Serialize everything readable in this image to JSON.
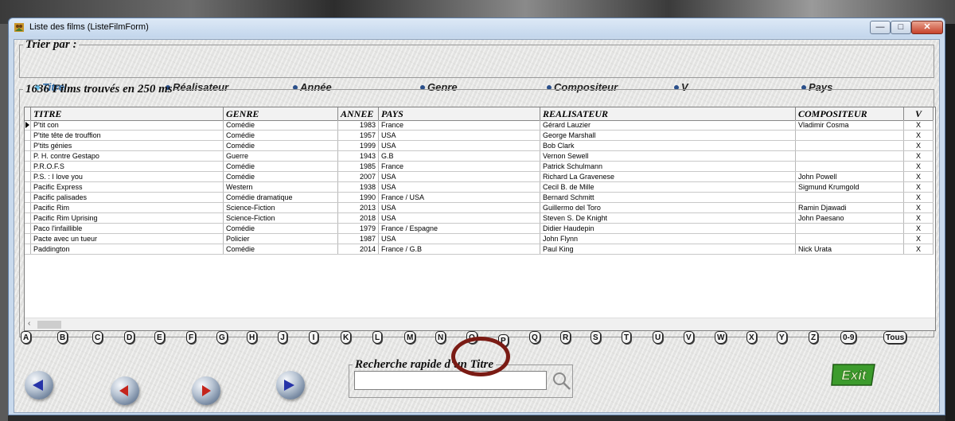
{
  "window": {
    "title": "Liste des films (ListeFilmForm)",
    "controls": {
      "minimize": "—",
      "maximize": "□",
      "close": "✕"
    }
  },
  "sort": {
    "legend": "Trier par :",
    "options": [
      {
        "label": "Titre",
        "checked": true
      },
      {
        "label": "Réalisateur",
        "checked": false
      },
      {
        "label": "Année",
        "checked": false
      },
      {
        "label": "Genre",
        "checked": false
      },
      {
        "label": "Compositeur",
        "checked": false
      },
      {
        "label": "V",
        "checked": false
      },
      {
        "label": "Pays",
        "checked": false
      }
    ]
  },
  "results": {
    "legend": "1636 Films trouvés en 250 ms"
  },
  "grid": {
    "columns": [
      "TITRE",
      "GENRE",
      "ANNEE",
      "PAYS",
      "REALISATEUR",
      "COMPOSITEUR",
      "V"
    ],
    "rows": [
      [
        "P'tit con",
        "Comédie",
        "1983",
        "France",
        "Gérard Lauzier",
        "Vladimir Cosma",
        "X"
      ],
      [
        "P'tite tête de trouffion",
        "Comédie",
        "1957",
        "USA",
        "George Marshall",
        "",
        "X"
      ],
      [
        "P'tits génies",
        "Comédie",
        "1999",
        "USA",
        "Bob Clark",
        "",
        "X"
      ],
      [
        "P. H. contre Gestapo",
        "Guerre",
        "1943",
        "G.B",
        "Vernon Sewell",
        "",
        "X"
      ],
      [
        "P.R.O.F.S",
        "Comédie",
        "1985",
        "France",
        "Patrick Schulmann",
        "",
        "X"
      ],
      [
        "P.S. : I love you",
        "Comédie",
        "2007",
        "USA",
        "Richard La Gravenese",
        "John Powell",
        "X"
      ],
      [
        "Pacific Express",
        "Western",
        "1938",
        "USA",
        "Cecil B. de Mille",
        "Sigmund Krumgold",
        "X"
      ],
      [
        "Pacific palisades",
        "Comédie dramatique",
        "1990",
        "France / USA",
        "Bernard Schmitt",
        "",
        "X"
      ],
      [
        "Pacific Rim",
        "Science-Fiction",
        "2013",
        "USA",
        "Guillermo del Toro",
        "Ramin Djawadi",
        "X"
      ],
      [
        "Pacific Rim Uprising",
        "Science-Fiction",
        "2018",
        "USA",
        "Steven S. De Knight",
        "John Paesano",
        "X"
      ],
      [
        "Paco l'infaillible",
        "Comédie",
        "1979",
        "France / Espagne",
        "Didier Haudepin",
        "",
        "X"
      ],
      [
        "Pacte avec un tueur",
        "Policier",
        "1987",
        "USA",
        "John Flynn",
        "",
        "X"
      ],
      [
        "Paddington",
        "Comédie",
        "2014",
        "France / G.B",
        "Paul King",
        "Nick Urata",
        "X"
      ]
    ]
  },
  "letters": [
    "A",
    "B",
    "C",
    "D",
    "E",
    "F",
    "G",
    "H",
    "J",
    "I",
    "K",
    "L",
    "M",
    "N",
    "O",
    "P",
    "Q",
    "R",
    "S",
    "T",
    "U",
    "V",
    "W",
    "X",
    "Y",
    "Z",
    "0-9",
    "Tous"
  ],
  "search": {
    "legend": "Recherche rapide d'un Titre",
    "value": "",
    "placeholder": ""
  },
  "exit": {
    "label": "Exit"
  },
  "colors": {
    "circle_mark": "#7a1b14",
    "exit_green": "#3c9b2c",
    "radio_checked": "#6cc3ee"
  }
}
